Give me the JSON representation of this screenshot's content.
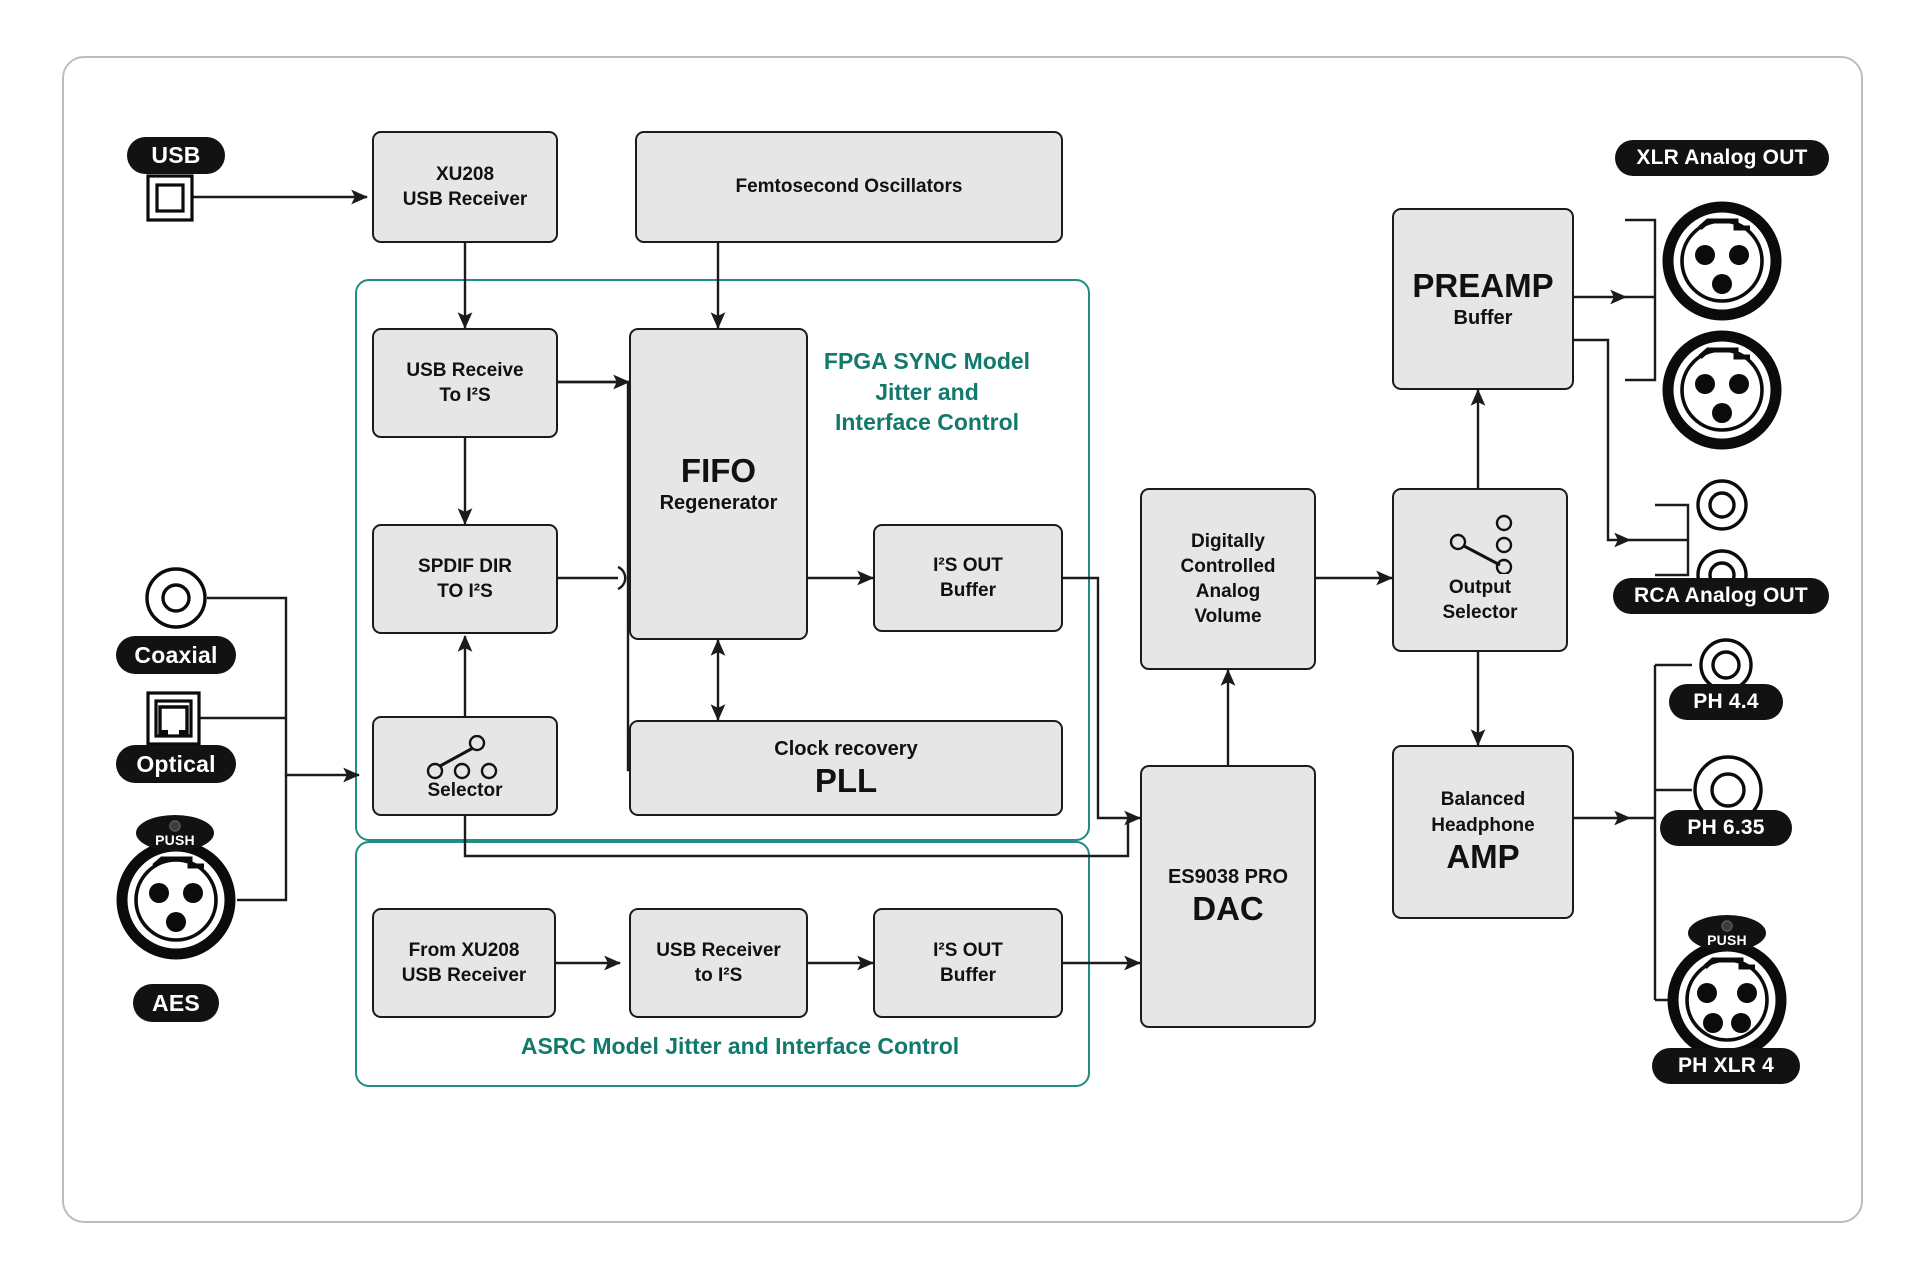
{
  "diagram": {
    "title": "DAC signal path block diagram",
    "accent_teal": "#12796c",
    "block_fill": "#e6e6e6",
    "block_stroke": "#1b1b1b",
    "pill_bg": "#121212"
  },
  "inputs": [
    {
      "id": "usb",
      "label": "USB",
      "icon": "usb-port-icon"
    },
    {
      "id": "coaxial",
      "label": "Coaxial",
      "icon": "rca-coax-jack-icon"
    },
    {
      "id": "optical",
      "label": "Optical",
      "icon": "toslink-optical-jack-icon"
    },
    {
      "id": "aes",
      "label": "AES",
      "icon": "xlr-3pin-female-icon",
      "push": "PUSH"
    }
  ],
  "outputs": [
    {
      "id": "xlr_out",
      "label": "XLR Analog OUT",
      "icon": "xlr-3pin-female-icon"
    },
    {
      "id": "rca_out",
      "label": "RCA Analog OUT",
      "icon": "rca-jack-icon"
    },
    {
      "id": "ph44",
      "label": "PH 4.4",
      "icon": "pentaconn-jack-icon"
    },
    {
      "id": "ph635",
      "label": "PH 6.35",
      "icon": "trs-jack-icon"
    },
    {
      "id": "phxlr4",
      "label": "PH XLR 4",
      "icon": "xlr-4pin-female-icon",
      "push": "PUSH"
    }
  ],
  "blocks": {
    "xu208": {
      "line1": "XU208",
      "line2": "USB Receiver"
    },
    "femto": {
      "line1": "Femtosecond Oscillators"
    },
    "usb_to_i2s": {
      "line1": "USB Receive",
      "line2": "To I²S"
    },
    "spdif_dir": {
      "line1": "SPDIF DIR",
      "line2": "TO I²S"
    },
    "selector": {
      "line1": "Selector"
    },
    "fifo": {
      "big": "FIFO",
      "sub": "Regenerator"
    },
    "i2s_out_top": {
      "line1": "I²S OUT",
      "line2": "Buffer"
    },
    "pll": {
      "sub": "Clock recovery",
      "big": "PLL"
    },
    "from_xu208": {
      "line1": "From XU208",
      "line2": "USB Receiver"
    },
    "usb_rx_i2s": {
      "line1": "USB Receiver",
      "line2": "to I²S"
    },
    "i2s_out_bot": {
      "line1": "I²S OUT",
      "line2": "Buffer"
    },
    "dac": {
      "sub": "ES9038 PRO",
      "big": "DAC"
    },
    "volume": {
      "line1": "Digitally",
      "line2": "Controlled",
      "line3": "Analog",
      "line4": "Volume"
    },
    "out_selector": {
      "line1": "Output",
      "line2": "Selector"
    },
    "preamp": {
      "big": "PREAMP",
      "sub": "Buffer"
    },
    "hp_amp": {
      "line1": "Balanced",
      "line2": "Headphone",
      "big": "AMP"
    }
  },
  "groups": {
    "fpga": "FPGA SYNC Model\nJitter and\nInterface Control",
    "asrc": "ASRC Model Jitter and Interface Control"
  }
}
